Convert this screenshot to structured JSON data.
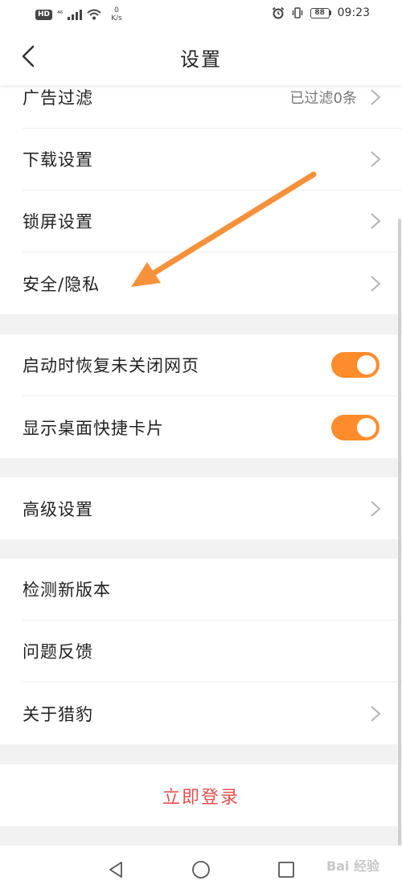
{
  "status_bar": {
    "hd_badge": "HD",
    "network": "⁴⁶",
    "speed_value": "0",
    "speed_unit": "K/s",
    "battery": "88",
    "time": "09:23"
  },
  "header": {
    "title": "设置",
    "back_icon": "chevron-left-icon"
  },
  "section1": {
    "items": [
      {
        "label": "广告过滤",
        "value": "已过滤0条"
      },
      {
        "label": "下载设置"
      },
      {
        "label": "锁屏设置"
      },
      {
        "label": "安全/隐私"
      }
    ]
  },
  "section2": {
    "items": [
      {
        "label": "启动时恢复未关闭网页",
        "enabled": true
      },
      {
        "label": "显示桌面快捷卡片",
        "enabled": true
      }
    ]
  },
  "section3": {
    "items": [
      {
        "label": "高级设置"
      }
    ]
  },
  "section4": {
    "items": [
      {
        "label": "检测新版本"
      },
      {
        "label": "问题反馈"
      },
      {
        "label": "关于猎豹"
      }
    ]
  },
  "login": {
    "label": "立即登录"
  },
  "watermark": "Bai 经验",
  "colors": {
    "accent": "#ff8c2b",
    "login_text": "#e5514f",
    "annotation_arrow": "#f5913a"
  }
}
